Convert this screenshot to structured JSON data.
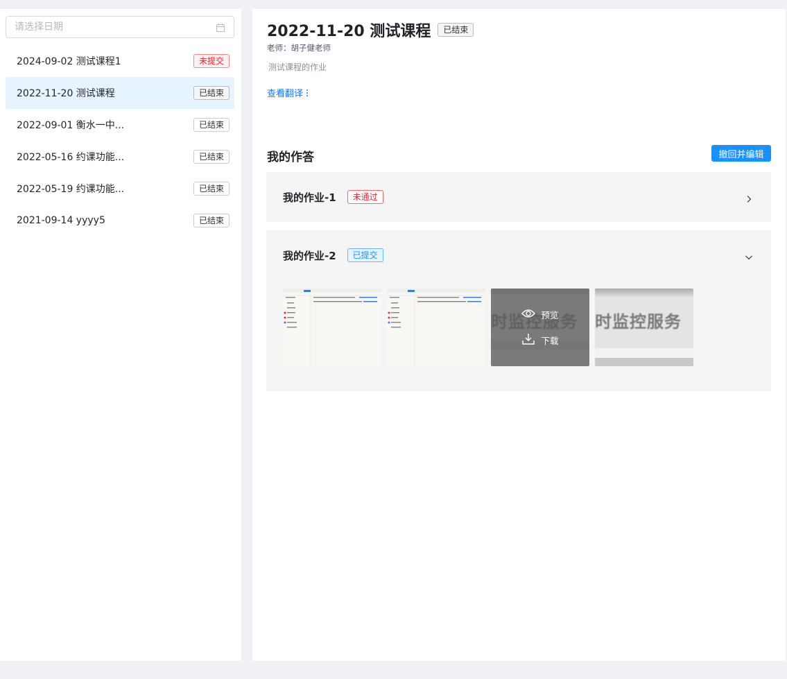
{
  "sidebar": {
    "date_placeholder": "请选择日期",
    "courses": [
      {
        "title": "2024-09-02 测试课程1",
        "status": "未提交"
      },
      {
        "title": "2022-11-20 测试课程",
        "status": "已结束"
      },
      {
        "title": "2022-09-01 衡水一中...",
        "status": "已结束"
      },
      {
        "title": "2022-05-16 约课功能...",
        "status": "已结束"
      },
      {
        "title": "2022-05-19 约课功能...",
        "status": "已结束"
      },
      {
        "title": "2021-09-14 yyyy5",
        "status": "已结束"
      }
    ],
    "active_index": 1
  },
  "course": {
    "title": "2022-11-20 测试课程",
    "status": "已结束",
    "teacher": "老师：胡子健老师",
    "description": "测试课程的作业",
    "translate_label": "查看翻译"
  },
  "answers": {
    "section_title": "我的作答",
    "withdraw_label": "撤回并编辑",
    "homeworks": [
      {
        "name": "我的作业-1",
        "status": "未通过",
        "expanded": false
      },
      {
        "name": "我的作业-2",
        "status": "已提交",
        "expanded": true
      }
    ],
    "attachment_actions": {
      "preview": "预览",
      "download": "下载"
    },
    "thumb_text": "时监控服务"
  },
  "colors": {
    "primary": "#1890ff",
    "active_bg": "#e6f4ff",
    "danger": "#f5222d",
    "panel_bg": "#f5f5f5",
    "page_bg": "#f0f1f5"
  }
}
